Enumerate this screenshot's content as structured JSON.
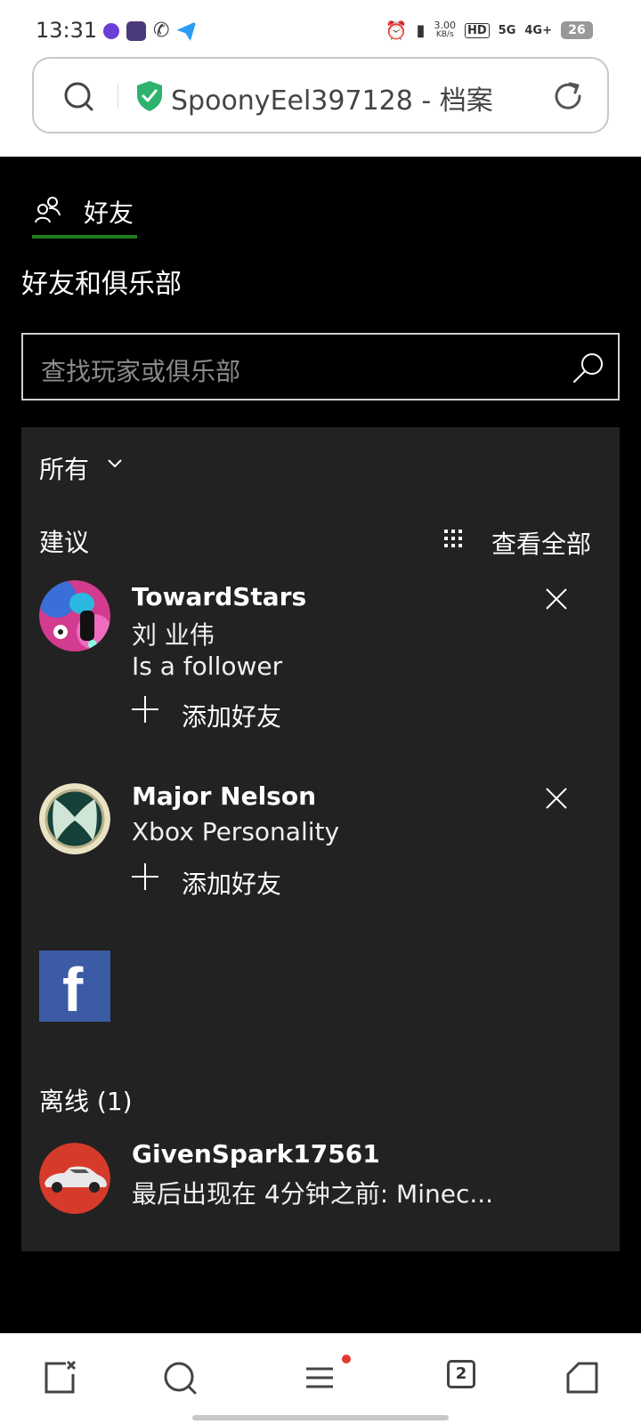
{
  "status_bar": {
    "time": "13:31",
    "net_speed": "3.00",
    "net_unit": "KB/s",
    "hd_label": "HD",
    "net_5g": "5G",
    "net_4g": "4G+",
    "battery": "26"
  },
  "browser": {
    "address_title": "SpoonyEel397128 - 档案",
    "tab_count": "2"
  },
  "page": {
    "tab_label": "好友",
    "section_title": "好友和俱乐部",
    "search_placeholder": "查找玩家或俱乐部",
    "filter_label": "所有",
    "suggestions_label": "建议",
    "view_all_label": "查看全部",
    "suggestions": [
      {
        "name": "TowardStars",
        "real_name": "刘 业伟",
        "detail": "Is a follower",
        "add_label": "添加好友"
      },
      {
        "name": "Major Nelson",
        "detail": "Xbox Personality",
        "add_label": "添加好友"
      }
    ],
    "facebook_letter": "f",
    "offline_label": "离线 (1)",
    "offline": [
      {
        "name": "GivenSpark17561",
        "detail": "最后出现在 4分钟之前: Minec..."
      }
    ]
  },
  "colors": {
    "tab_underline": "#1e7d1e",
    "panel_bg": "#222222",
    "facebook_blue": "#3b5ba5",
    "shield_green": "#2db36d"
  }
}
